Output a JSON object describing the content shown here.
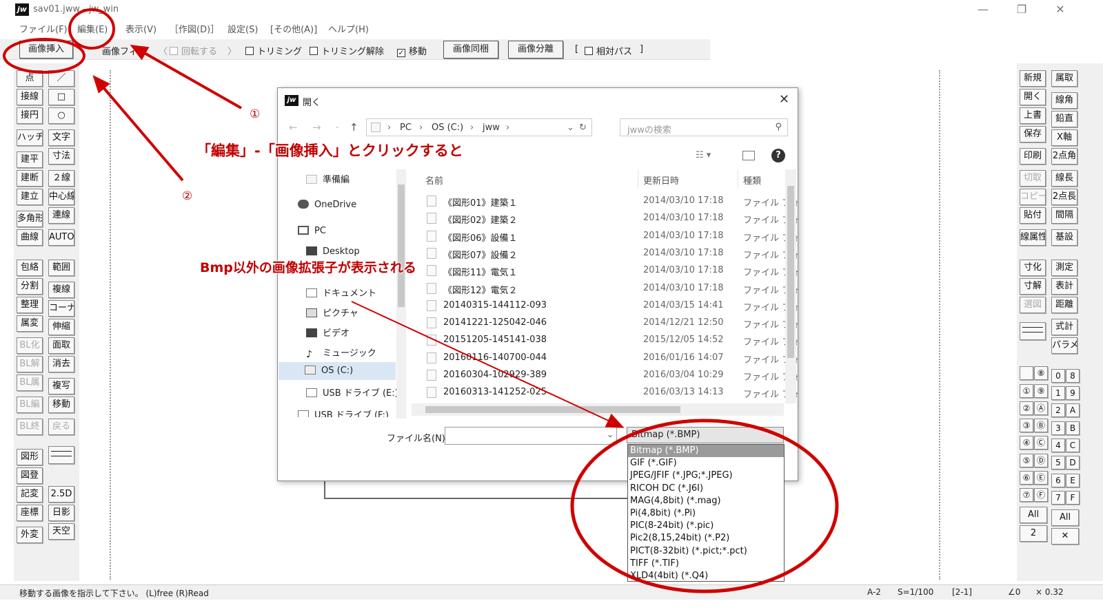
{
  "window": {
    "title": "sav01.jww - jw_win",
    "app_icon": "jw",
    "controls": [
      "—",
      "❐",
      "✕"
    ]
  },
  "menu": [
    "ファイル(F)",
    "編集(E)",
    "表示(V)",
    "［作図(D)］",
    "設定(S)",
    "[その他(A)]",
    "ヘルプ(H)"
  ],
  "toolbar": {
    "insert_image": "画像挿入",
    "image_fit_partial": "画像フィ",
    "rotate_label": "回転する",
    "rotate_paren_open": "〈",
    "rotate_paren_close": "〉",
    "trimming": "トリミング",
    "trimming_release": "トリミング解除",
    "move": "移動",
    "same_image": "画像同梱",
    "split_image": "画像分離",
    "relative_path": "相対パス",
    "relative_bracket_open": "[",
    "relative_bracket_close": "]"
  },
  "left_tools": {
    "col1": [
      "点",
      "接線",
      "接円",
      "ハッチ",
      "建平",
      "建断",
      "建立",
      "多角形",
      "曲線",
      "包絡",
      "分割",
      "整理",
      "属変",
      "BL化",
      "BL解",
      "BL属",
      "BL編",
      "BL終",
      "図形",
      "図登",
      "記変",
      "座標",
      "外変"
    ],
    "col2": [
      "／",
      "□",
      "○",
      "文字",
      "寸法",
      "２線",
      "中心線",
      "連線",
      "AUTO",
      "範囲",
      "複線",
      "コーナー",
      "伸縮",
      "面取",
      "消去",
      "複写",
      "移動",
      "戻る",
      "2.5D",
      "日影",
      "天空"
    ]
  },
  "right_tools": {
    "col1": [
      "新規",
      "開く",
      "上書",
      "保存",
      "印刷",
      "切取",
      "コピー",
      "貼付",
      "線属性",
      "寸化",
      "寸解",
      "選図"
    ],
    "col2": [
      "属取",
      "線角",
      "鉛直",
      "X軸",
      "2点角",
      "線長",
      "2点長",
      "間隔",
      "基設",
      "測定",
      "表計",
      "距離",
      "式計",
      "パラメ"
    ],
    "layers_left": [
      "⑧",
      "⑨",
      "Ⓐ",
      "Ⓑ",
      "Ⓒ",
      "Ⓓ",
      "Ⓔ",
      "Ⓕ"
    ],
    "layers_left_num": [
      "",
      "①",
      "②",
      "③",
      "④",
      "⑤",
      "⑥",
      "⑦"
    ],
    "layers_right_num": [
      "0",
      "1",
      "2",
      "3",
      "4",
      "5",
      "6",
      "7"
    ],
    "layers_right_char": [
      "8",
      "9",
      "A",
      "B",
      "C",
      "D",
      "E",
      "F"
    ],
    "all_left": "All",
    "all_right": "All",
    "two": "2",
    "cross": "✕"
  },
  "status": {
    "message": "移動する画像を指示して下さい。 (L)free (R)Read",
    "paper": "A-2",
    "scale": "S=1/100",
    "layer": "[2-1]",
    "angle": "∠0",
    "factor": "× 0.32"
  },
  "dialog": {
    "icon": "jw",
    "title": "開く",
    "close": "✕",
    "breadcrumb": [
      "PC",
      "OS (C:)",
      "jww"
    ],
    "search_placeholder": "jwwの検索",
    "nav_items": [
      "準備編",
      "OneDrive",
      "PC",
      "Desktop",
      "ドキュメント",
      "ピクチャ",
      "ビデオ",
      "ミュージック",
      "OS (C:)",
      "USB ドライブ (E:)",
      "USB ドライブ (F:)"
    ],
    "columns": {
      "name": "名前",
      "date": "更新日時",
      "type": "種類"
    },
    "files": [
      {
        "name": "《図形01》建築１",
        "date": "2014/03/10 17:18",
        "type": "ファイル フォ"
      },
      {
        "name": "《図形02》建築２",
        "date": "2014/03/10 17:18",
        "type": "ファイル フォ"
      },
      {
        "name": "《図形06》設備１",
        "date": "2014/03/10 17:18",
        "type": "ファイル フォ"
      },
      {
        "name": "《図形07》設備２",
        "date": "2014/03/10 17:18",
        "type": "ファイル フォ"
      },
      {
        "name": "《図形11》電気１",
        "date": "2014/03/10 17:18",
        "type": "ファイル フォ"
      },
      {
        "name": "《図形12》電気２",
        "date": "2014/03/10 17:18",
        "type": "ファイル フォ"
      },
      {
        "name": "20140315-144112-093",
        "date": "2014/03/15 14:41",
        "type": "ファイル フォ"
      },
      {
        "name": "20141221-125042-046",
        "date": "2014/12/21 12:50",
        "type": "ファイル フォ"
      },
      {
        "name": "20151205-145141-038",
        "date": "2015/12/05 14:52",
        "type": "ファイル フォ"
      },
      {
        "name": "20160116-140700-044",
        "date": "2016/01/16 14:07",
        "type": "ファイル フォ"
      },
      {
        "name": "20160304-102929-389",
        "date": "2016/03/04 10:29",
        "type": "ファイル フォ"
      },
      {
        "name": "20160313-141252-025",
        "date": "2016/03/13 14:13",
        "type": "ファイル フォ"
      }
    ],
    "filename_label": "ファイル名(N):",
    "filename_value": "",
    "filetype_selected": "Bitmap (*.BMP)",
    "filetype_options": [
      "Bitmap (*.BMP)",
      "GIF (*.GIF)",
      "JPEG/JFIF (*.JPG;*.JPEG)",
      "RICOH DC (*.J6I)",
      "MAG(4,8bit) (*.mag)",
      "Pi(4,8bit) (*.Pi)",
      "PIC(8-24bit) (*.pic)",
      "Pic2(8,15,24bit) (*.P2)",
      "PICT(8-32bit) (*.pict;*.pct)",
      "TIFF (*.TIF)",
      "XLD4(4bit) (*.Q4)"
    ]
  },
  "annotations": {
    "caption1": "「編集」-「画像挿入」とクリックすると",
    "caption2": "Bmp以外の画像拡張子が表示される",
    "num1": "①",
    "num2": "②",
    "color": "#c00000"
  }
}
